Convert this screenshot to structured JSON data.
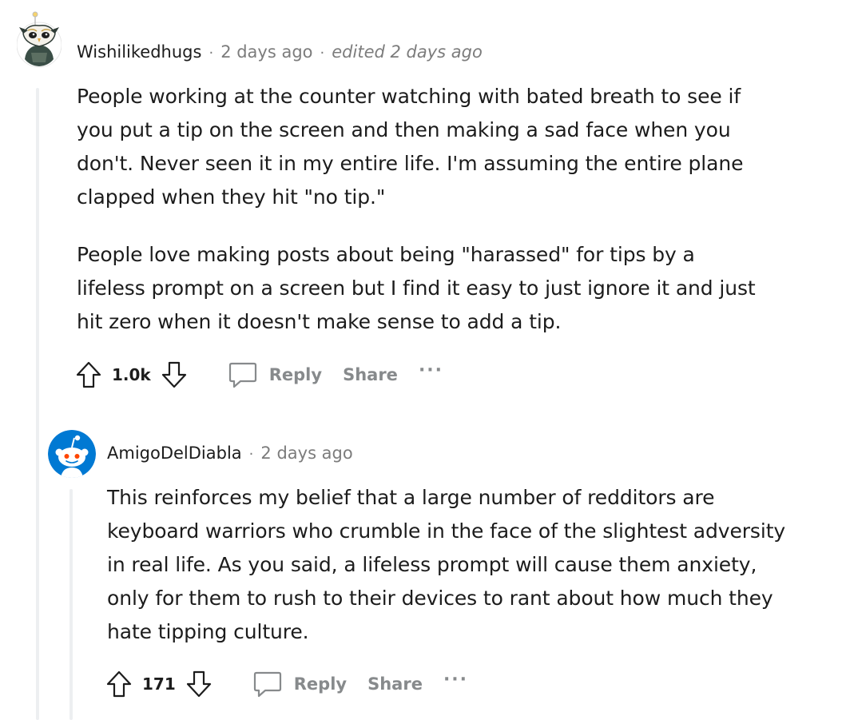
{
  "comments": [
    {
      "username": "Wishilikedhugs",
      "separator": "·",
      "time": "2 days ago",
      "edited_separator": "·",
      "edited": "edited 2 days ago",
      "avatar_icon": "owl-mask-avatar-icon",
      "paragraphs": [
        "People working at the counter watching with bated breath to see if you put a tip on the screen and then making a sad face when you don't. Never seen it in my entire life. I'm assuming the entire plane clapped when they hit \"no tip.\"",
        "People love making posts about being \"harassed\" for tips by a lifeless prompt on a screen but I find it easy to just ignore it and just hit zero when it doesn't make sense to add a tip."
      ],
      "votes": "1.0k",
      "reply_label": "Reply",
      "share_label": "Share",
      "more_label": "···"
    },
    {
      "username": "AmigoDelDiabla",
      "separator": "·",
      "time": "2 days ago",
      "avatar_icon": "snoo-avatar-icon",
      "paragraphs": [
        "This reinforces my belief that a large number of redditors are keyboard warriors who crumble in the face of the slightest adversity in real life. As you said, a lifeless prompt will cause them anxiety, only for them to rush to their devices to rant about how much they hate tipping culture."
      ],
      "votes": "171",
      "reply_label": "Reply",
      "share_label": "Share",
      "more_label": "···"
    }
  ],
  "colors": {
    "text": "#1c1c1c",
    "meta": "#7c7c7c",
    "action": "#878a8c",
    "thread_line": "#edeff1",
    "snoo_blue": "#0079d3"
  }
}
